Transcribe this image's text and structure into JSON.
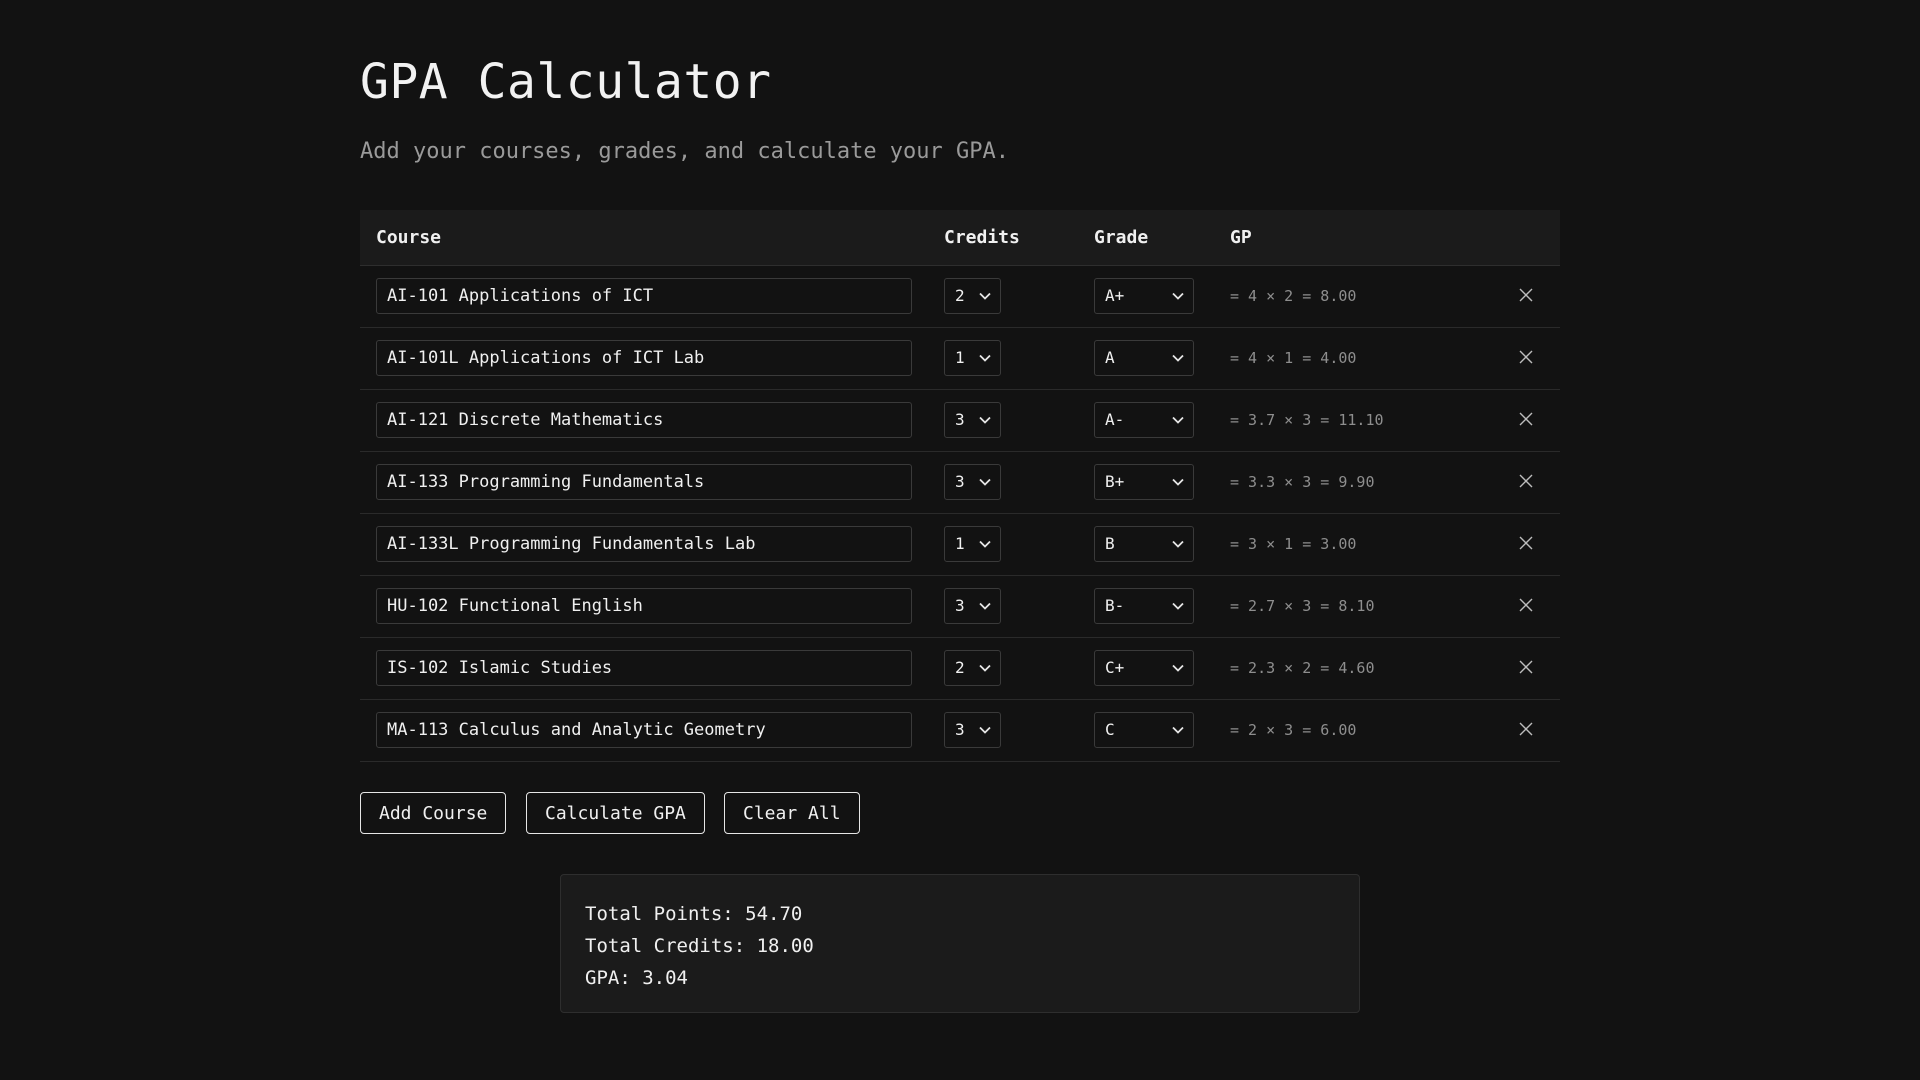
{
  "header": {
    "title": "GPA Calculator",
    "subtitle": "Add your courses, grades, and calculate your GPA."
  },
  "table": {
    "columns": [
      "Course",
      "Credits",
      "Grade",
      "GP"
    ],
    "rows": [
      {
        "course": "AI-101 Applications of ICT",
        "credits": "2",
        "grade": "A+",
        "gp": "= 4 × 2 = 8.00"
      },
      {
        "course": "AI-101L Applications of ICT Lab",
        "credits": "1",
        "grade": "A",
        "gp": "= 4 × 1 = 4.00"
      },
      {
        "course": "AI-121 Discrete Mathematics",
        "credits": "3",
        "grade": "A-",
        "gp": "= 3.7 × 3 = 11.10"
      },
      {
        "course": "AI-133 Programming Fundamentals",
        "credits": "3",
        "grade": "B+",
        "gp": "= 3.3 × 3 = 9.90"
      },
      {
        "course": "AI-133L Programming Fundamentals Lab",
        "credits": "1",
        "grade": "B",
        "gp": "= 3 × 1 = 3.00"
      },
      {
        "course": "HU-102 Functional English",
        "credits": "3",
        "grade": "B-",
        "gp": "= 2.7 × 3 = 8.10"
      },
      {
        "course": "IS-102 Islamic Studies",
        "credits": "2",
        "grade": "C+",
        "gp": "= 2.3 × 2 = 4.60"
      },
      {
        "course": "MA-113 Calculus and Analytic Geometry",
        "credits": "3",
        "grade": "C",
        "gp": "= 2 × 3 = 6.00"
      }
    ]
  },
  "actions": {
    "add_course": "Add Course",
    "calculate": "Calculate GPA",
    "clear_all": "Clear All"
  },
  "summary": {
    "total_points": "Total Points: 54.70",
    "total_credits": "Total Credits: 18.00",
    "gpa": "GPA: 3.04"
  },
  "icons": {
    "select_arrow": "chevron-down-icon",
    "remove": "close-icon"
  },
  "colors": {
    "background": "#121212",
    "panel": "#1b1b1b",
    "text": "#f0f0f0",
    "muted": "#8e8e8e"
  }
}
